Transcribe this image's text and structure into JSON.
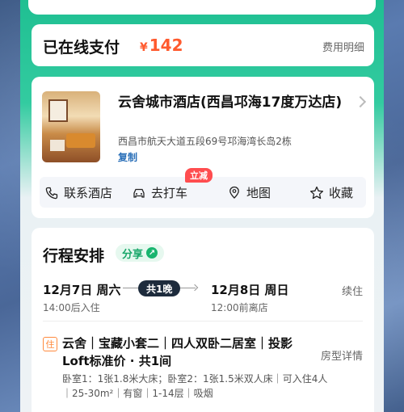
{
  "payment": {
    "title": "已在线支付",
    "currency": "¥",
    "amount": "142",
    "detail_link": "费用明细"
  },
  "hotel": {
    "name": "云舍城市酒店(西昌邛海17度万达店)",
    "address": "西昌市航天大道五段69号邛海湾长岛2栋",
    "copy_label": "复制",
    "actions": [
      {
        "label": "联系酒店",
        "icon": "phone-icon"
      },
      {
        "label": "去打车",
        "icon": "car-icon",
        "badge": "立减"
      },
      {
        "label": "地图",
        "icon": "map-pin-icon"
      },
      {
        "label": "收藏",
        "icon": "star-icon"
      }
    ]
  },
  "trip": {
    "title": "行程安排",
    "share_label": "分享",
    "checkin_date": "12月7日 周六",
    "checkin_time": "14:00后入住",
    "nights": "共1晚",
    "checkout_date": "12月8日 周日",
    "checkout_time": "12:00前离店",
    "continue_label": "续住",
    "room_tag": "住",
    "room_name": "云舍｜宝藏小套二｜四人双卧二居室｜投影Loft标准价 · 共1间",
    "room_detail_link": "房型详情",
    "room_desc": "卧室1：1张1.8米大床；卧室2：1张1.5米双人床｜可入住4人｜25-30m²｜有窗｜1-14层｜吸烟"
  },
  "colors": {
    "accent_green": "#1fbf92",
    "price_orange": "#ff5a2e",
    "badge_red": "#ff4d4f"
  }
}
